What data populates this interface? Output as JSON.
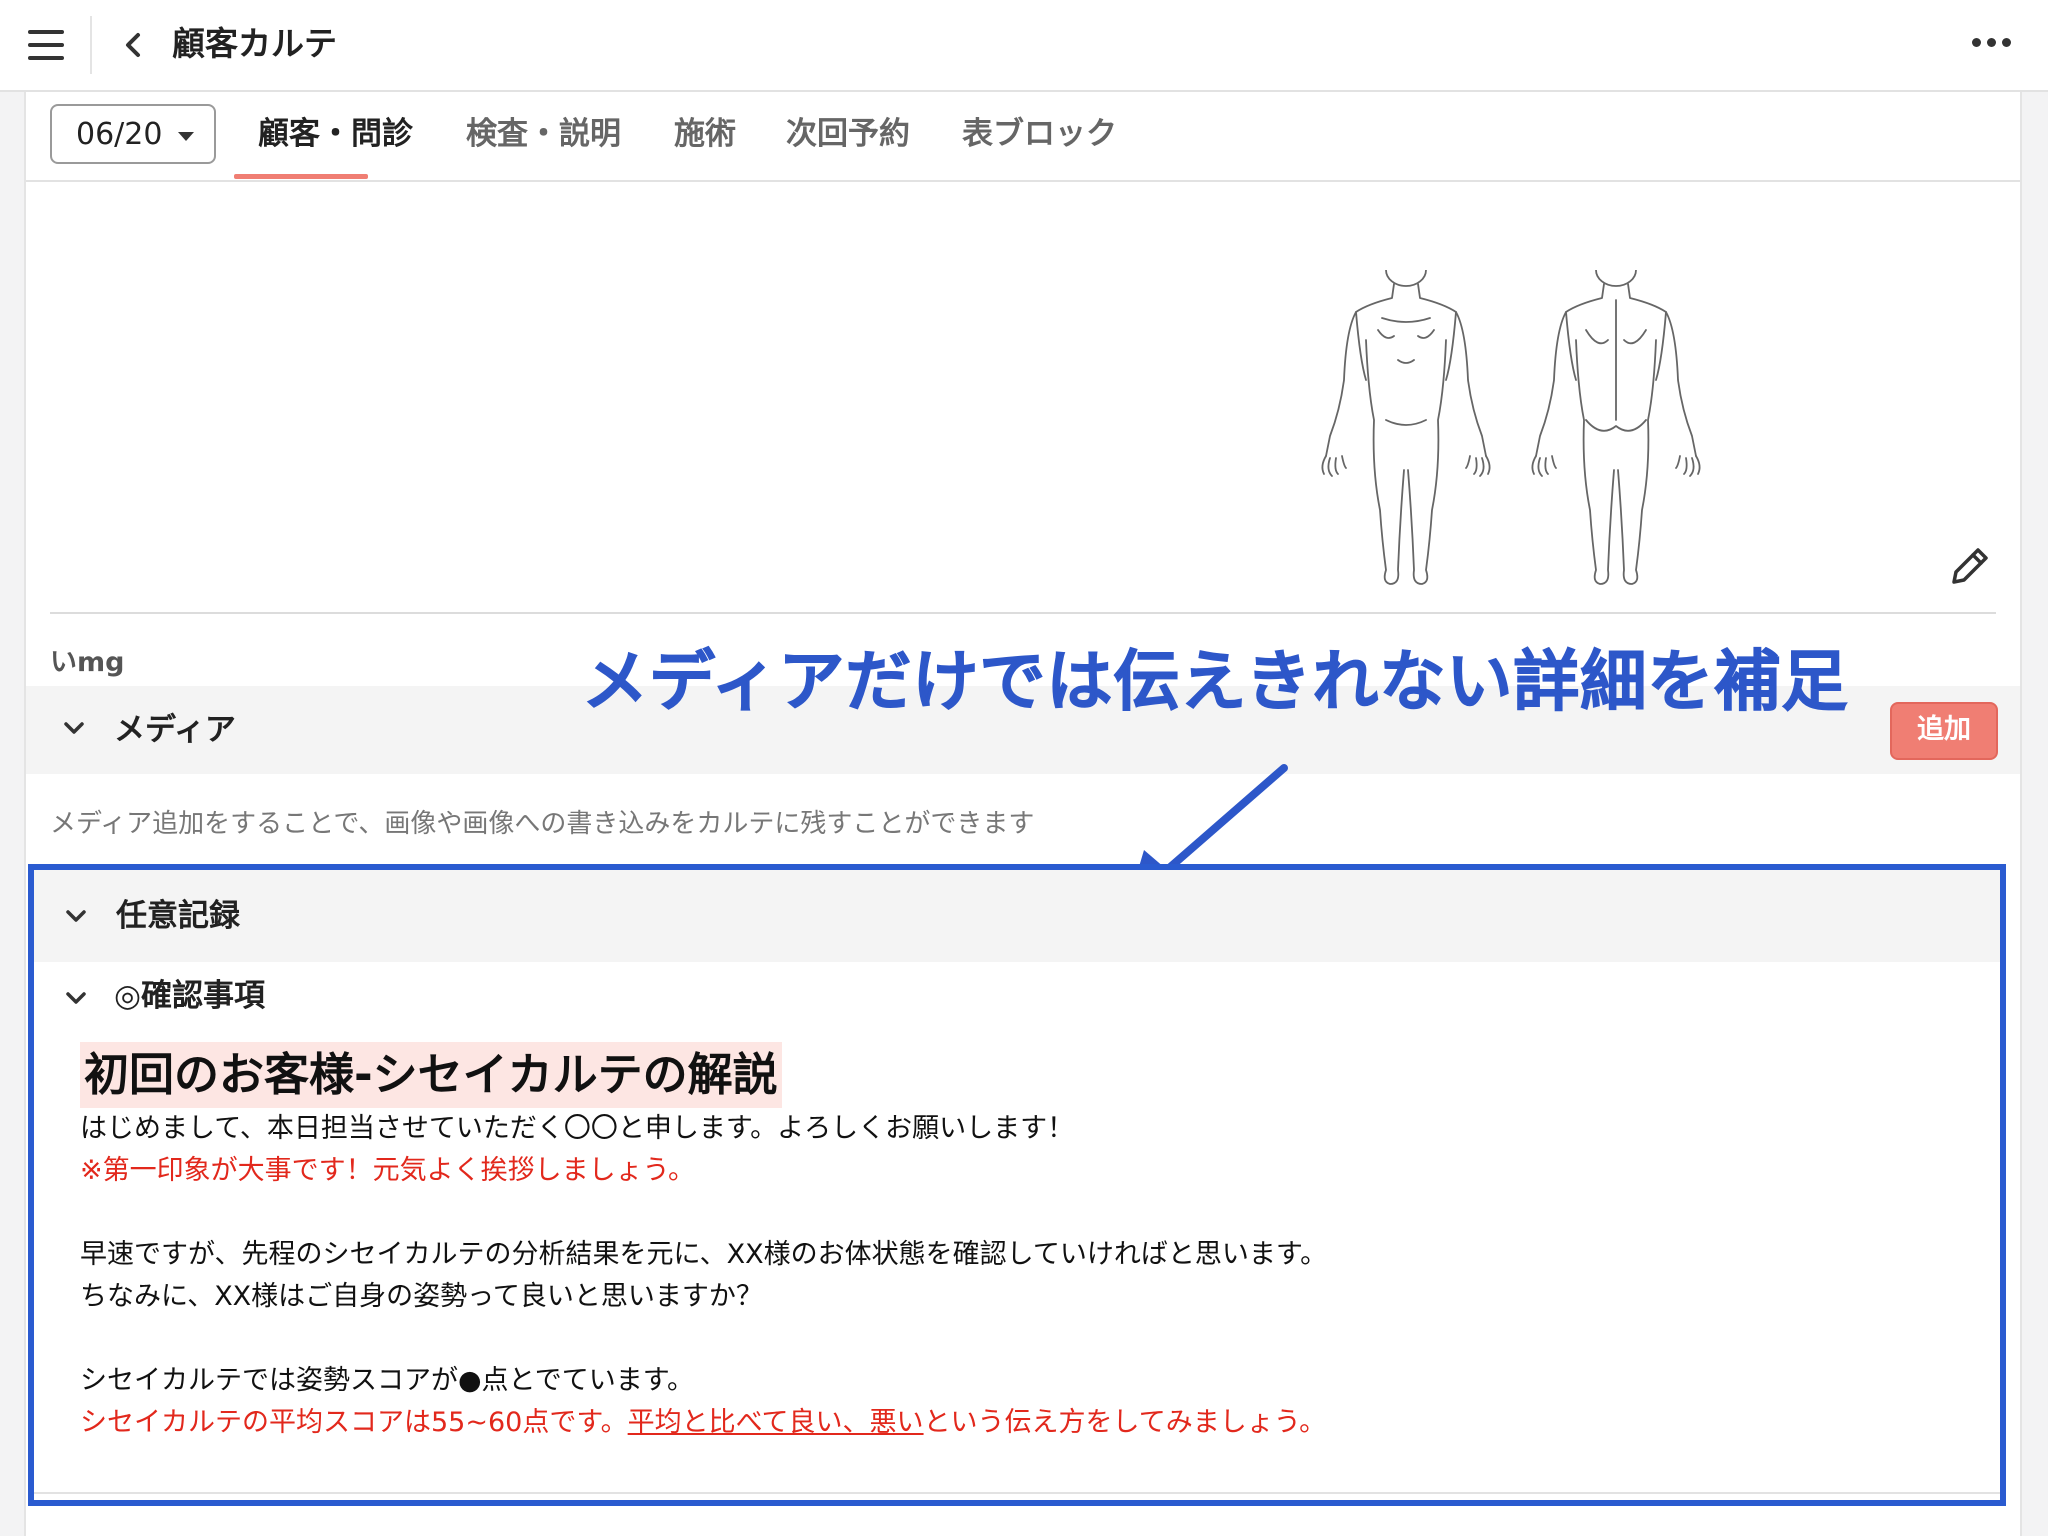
{
  "app": {
    "title": "顧客カルテ"
  },
  "tabs": {
    "date_value": "06/20",
    "items": [
      "顧客・問診",
      "検査・説明",
      "施術",
      "次回予約",
      "表ブロック"
    ],
    "active_index": 0
  },
  "body_chart": {
    "stub_text": "",
    "memo_label": "いmg"
  },
  "annotation": {
    "text": "メディアだけでは伝えきれない詳細を補足"
  },
  "media_section": {
    "title": "メディア",
    "add_label": "追加",
    "hint": "メディア追加をすることで、画像や画像への書き込みをカルテに残すことができます"
  },
  "record_section": {
    "title": "任意記録",
    "subsection_title": "◎確認事項",
    "heading": "初回のお客様-シセイカルテの解説",
    "lines": [
      "はじめまして、本日担当させていただく〇〇と申します。よろしくお願いします！",
      "※第一印象が大事です！元気よく挨拶しましょう。",
      "早速ですが、先程のシセイカルテの分析結果を元に、XX様のお体状態を確認していければと思います。",
      "ちなみに、XX様はご自身の姿勢って良いと思いますか？",
      "シセイカルテでは姿勢スコアが●点とでています。",
      "シセイカルテの平均スコアは55~60点です。",
      "平均と比べて良い、悪い",
      "という伝え方をしてみましょう。"
    ]
  },
  "colors": {
    "accent": "#f07e73",
    "annotation_blue": "#2d57c9",
    "note_red": "#e2281c",
    "heading_highlight": "#fde6e3"
  },
  "icons": [
    "menu-icon",
    "back-chevron-icon",
    "more-horizontal-icon",
    "caret-down-icon",
    "pencil-icon",
    "chevron-down-icon",
    "arrow-icon"
  ]
}
